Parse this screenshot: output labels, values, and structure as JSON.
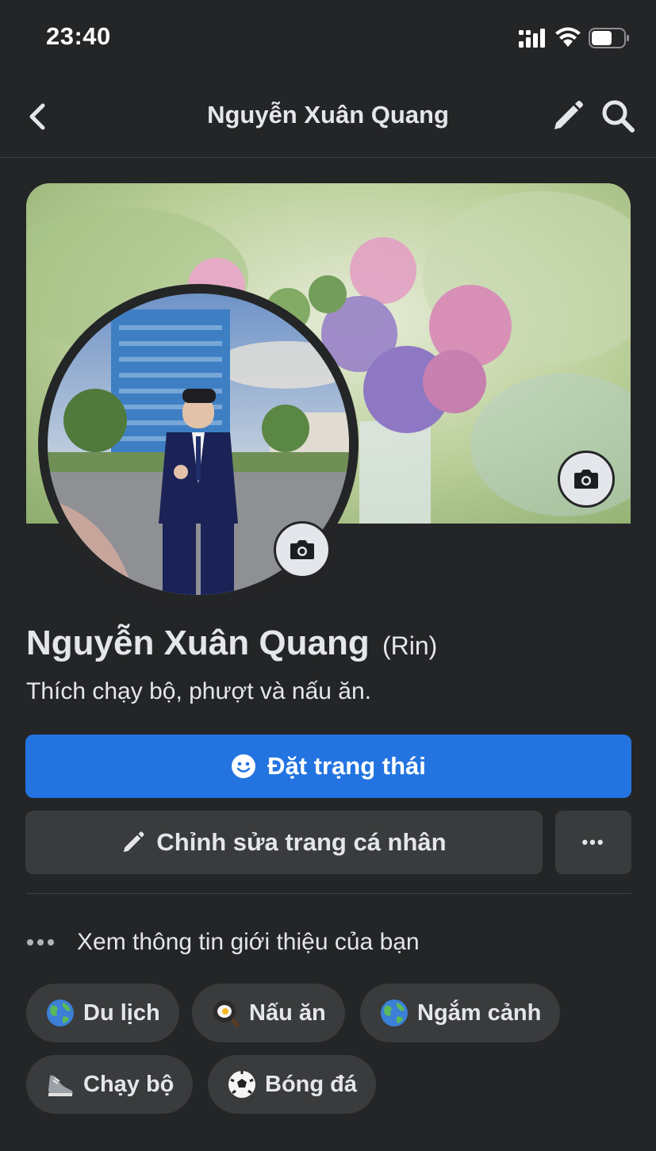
{
  "status_bar": {
    "time": "23:40"
  },
  "nav": {
    "title": "Nguyễn Xuân Quang"
  },
  "profile": {
    "name": "Nguyễn Xuân Quang",
    "nickname": "(Rin)",
    "bio": "Thích chạy bộ, phượt và nấu ăn."
  },
  "actions": {
    "status_label": "Đặt trạng thái",
    "edit_label": "Chỉnh sửa trang cá nhân",
    "more_label": "•••"
  },
  "about": {
    "label": "Xem thông tin giới thiệu của bạn"
  },
  "hobbies": [
    {
      "label": "Du lịch",
      "icon": "globe-icon"
    },
    {
      "label": "Nấu ăn",
      "icon": "cooking-icon"
    },
    {
      "label": "Ngắm cảnh",
      "icon": "globe-icon"
    },
    {
      "label": "Chạy bộ",
      "icon": "running-shoe-icon"
    },
    {
      "label": "Bóng đá",
      "icon": "soccer-ball-icon"
    }
  ],
  "colors": {
    "background": "#242526",
    "primary_button": "#2374e1",
    "secondary_button": "#3a3b3c",
    "text": "#e4e6eb"
  }
}
